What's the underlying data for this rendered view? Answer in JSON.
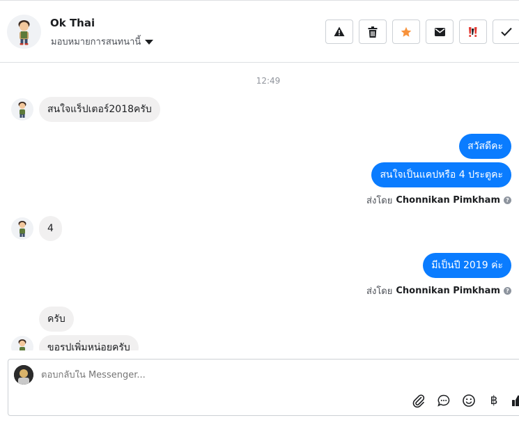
{
  "header": {
    "name": "Ok Thai",
    "assign_label": "มอบหมายการสนทนานี้"
  },
  "toolbar": {
    "icons": [
      "warning-icon",
      "trash-icon",
      "star-icon",
      "envelope-icon",
      "important-icon",
      "check-icon"
    ],
    "colors": {
      "star": "#f7923b",
      "important": "#e4342c"
    }
  },
  "thread": {
    "timestamp": "12:49",
    "messages": [
      {
        "dir": "in",
        "text": "สนใจแร็ปเตอร์2018ครับ"
      },
      {
        "dir": "out",
        "text": "สวัสดีคะ"
      },
      {
        "dir": "out",
        "text": "สนใจเป็นแคปหรือ 4 ประตูคะ"
      },
      {
        "dir": "in",
        "text": "4"
      },
      {
        "dir": "out",
        "text": "มีเป็นปี 2019 ค่ะ"
      },
      {
        "dir": "in",
        "text": "ครับ"
      },
      {
        "dir": "in",
        "text": "ขอรูปเพิ่มหน่อยครับ"
      }
    ],
    "sent_by_prefix": "ส่งโดย",
    "sent_by_name": "Chonnikan Pimkham",
    "bubble_out_color": "#0a7cff",
    "bubble_in_color": "#f1f0f0"
  },
  "composer": {
    "placeholder": "ตอบกลับใน Messenger...",
    "icons": [
      "paperclip-icon",
      "chat-bubble-icon",
      "emoji-icon",
      "baht-icon",
      "like-icon"
    ],
    "baht_symbol": "฿"
  }
}
